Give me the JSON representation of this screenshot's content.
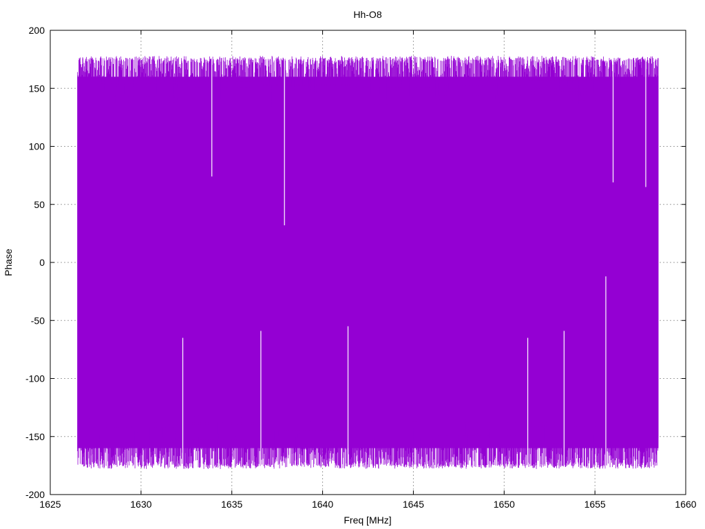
{
  "chart_data": {
    "type": "line",
    "title": "Hh-O8",
    "xlabel": "Freq [MHz]",
    "ylabel": "Phase",
    "xlim": [
      1625,
      1660
    ],
    "ylim": [
      -200,
      200
    ],
    "x_ticks": [
      1625,
      1630,
      1635,
      1640,
      1645,
      1650,
      1655,
      1660
    ],
    "y_ticks": [
      -200,
      -150,
      -100,
      -50,
      0,
      50,
      100,
      150,
      200
    ],
    "grid": true,
    "legend": "none",
    "series": [
      {
        "color": "#9400d3",
        "x_range": [
          1626.5,
          1658.5
        ],
        "envelope": {
          "upper": 180,
          "lower": -180
        },
        "description_values": {
          "typical_max": 178,
          "typical_min": -178,
          "notable_low_peaks": [
            {
              "x": 1633.9,
              "max": 74
            },
            {
              "x": 1637.9,
              "max": 32
            },
            {
              "x": 1656.0,
              "max": 69
            },
            {
              "x": 1657.8,
              "max": 65
            }
          ],
          "notable_high_troughs": [
            {
              "x": 1632.3,
              "min": -65
            },
            {
              "x": 1636.6,
              "min": -59
            },
            {
              "x": 1641.4,
              "min": -55
            },
            {
              "x": 1655.6,
              "min": -12
            },
            {
              "x": 1653.3,
              "min": -59
            },
            {
              "x": 1651.3,
              "min": -65
            }
          ]
        }
      }
    ]
  }
}
